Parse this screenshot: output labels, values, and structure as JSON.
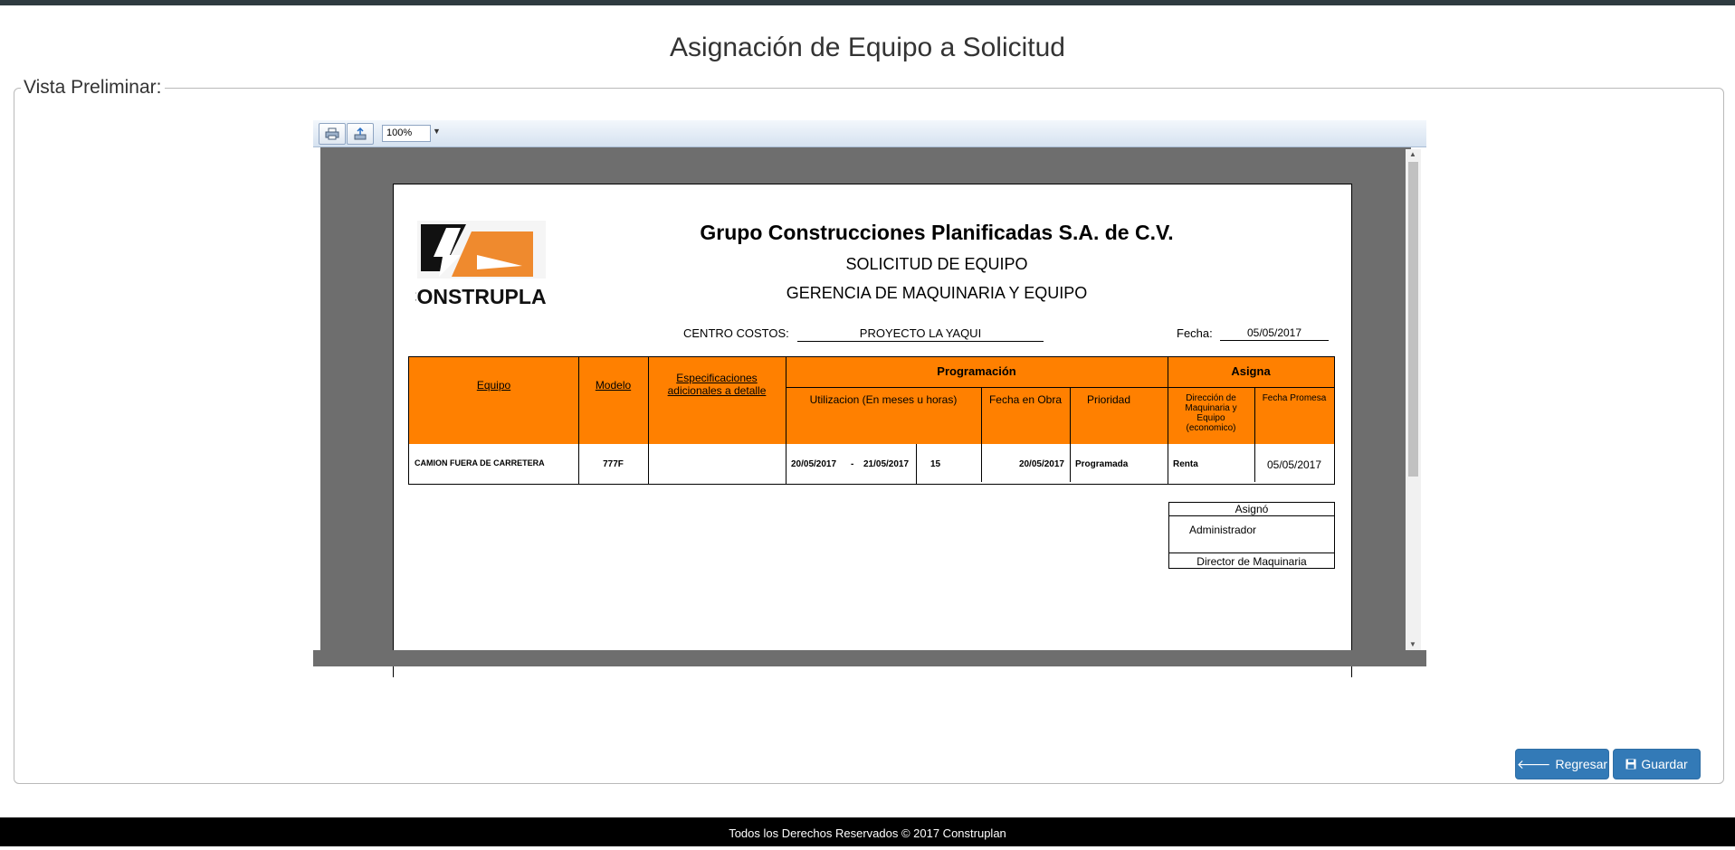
{
  "page": {
    "title": "Asignación de Equipo a Solicitud",
    "preview_legend": "Vista Preliminar:"
  },
  "viewer": {
    "zoom": "100%",
    "print_icon": "printer-icon",
    "export_icon": "export-icon"
  },
  "report": {
    "company": "Grupo Construcciones Planificadas S.A. de C.V.",
    "logo_text": "CONSTRUPLAN",
    "doc_title": "SOLICITUD DE EQUIPO",
    "department": "GERENCIA DE MAQUINARIA Y EQUIPO",
    "cost_center_label": "CENTRO COSTOS:",
    "cost_center_value": "PROYECTO LA YAQUI",
    "date_label": "Fecha:",
    "date_value": "05/05/2017",
    "headers": {
      "equipo": "Equipo",
      "modelo": "Modelo",
      "especificaciones": "Especificaciones adicionales a detalle",
      "programacion": "Programación",
      "asigna": "Asigna",
      "utilizacion": "Utilizacion (En meses u horas)",
      "fecha_obra": "Fecha en Obra",
      "prioridad": "Prioridad",
      "direccion": "Dirección de Maquinaria y Equipo (economico)",
      "fecha_promesa": "Fecha Promesa"
    },
    "row": {
      "equipo": "CAMION FUERA DE CARRETERA",
      "modelo": "777F",
      "especificaciones": "",
      "desde": "20/05/2017",
      "separator": "-",
      "hasta": "21/05/2017",
      "cantidad": "15",
      "fecha_obra": "20/05/2017",
      "prioridad": "Programada",
      "direccion": "Renta",
      "fecha_promesa": "05/05/2017"
    },
    "assigned": {
      "title": "Asignó",
      "name": "Administrador",
      "role": "Director de Maquinaria"
    }
  },
  "buttons": {
    "back": "Regresar",
    "save": "Guardar"
  },
  "footer": "Todos los Derechos Reservados © 2017 Construplan",
  "colors": {
    "orange": "#ff8000",
    "primary": "#337ab7"
  }
}
